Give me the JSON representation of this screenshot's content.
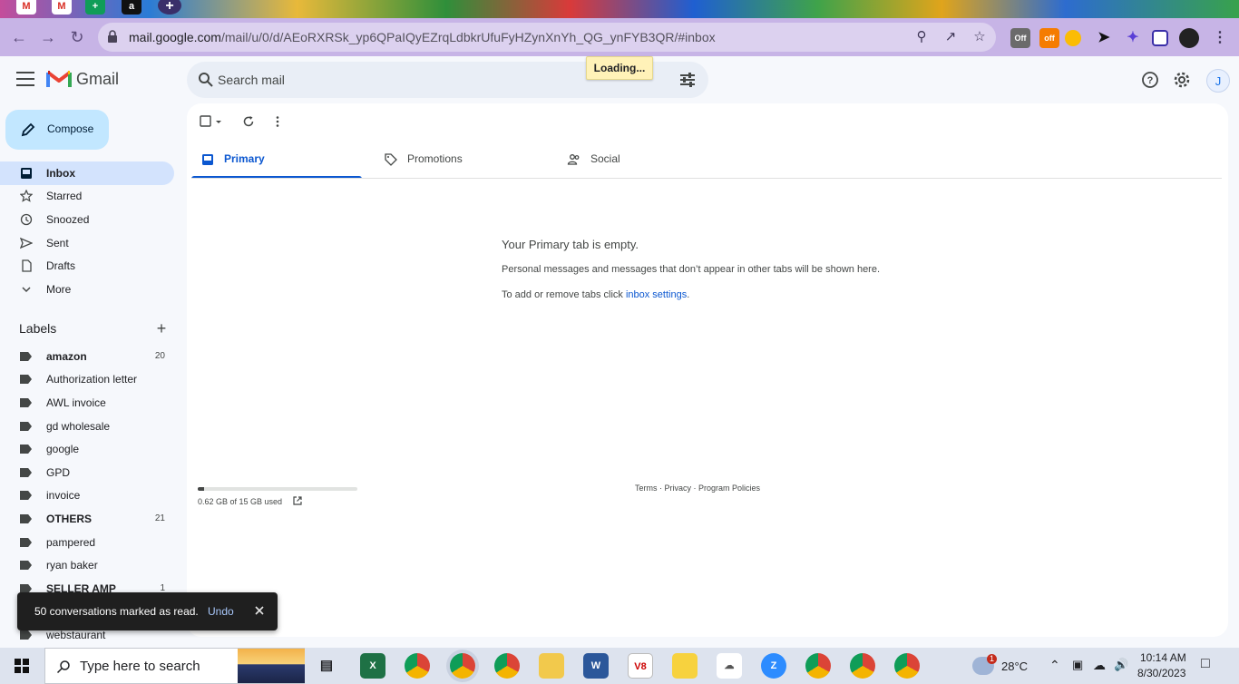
{
  "browser": {
    "url_host": "mail.google.com",
    "url_path": "/mail/u/0/d/AEoRXRSk_yp6QPaIQyEZrqLdbkrUfuFyHZynXnYh_QG_ynFYB3QR/#inbox",
    "ext_off_1": "Off",
    "ext_off_2": "off",
    "loading": "Loading..."
  },
  "header": {
    "app_name": "Gmail",
    "search_placeholder": "Search mail",
    "avatar_initial": "J"
  },
  "compose_label": "Compose",
  "nav": [
    {
      "label": "Inbox",
      "icon": "inbox-icon",
      "active": true
    },
    {
      "label": "Starred",
      "icon": "star-icon"
    },
    {
      "label": "Snoozed",
      "icon": "clock-icon"
    },
    {
      "label": "Sent",
      "icon": "send-icon"
    },
    {
      "label": "Drafts",
      "icon": "draft-icon"
    },
    {
      "label": "More",
      "icon": "chevron-down-icon"
    }
  ],
  "labels_title": "Labels",
  "labels": [
    {
      "name": "amazon",
      "count": "20",
      "bold": true
    },
    {
      "name": "Authorization letter",
      "count": ""
    },
    {
      "name": "AWL invoice",
      "count": ""
    },
    {
      "name": "gd wholesale",
      "count": ""
    },
    {
      "name": "google",
      "count": ""
    },
    {
      "name": "GPD",
      "count": ""
    },
    {
      "name": "invoice",
      "count": ""
    },
    {
      "name": "OTHERS",
      "count": "21",
      "bold": true
    },
    {
      "name": "pampered",
      "count": ""
    },
    {
      "name": "ryan baker",
      "count": ""
    },
    {
      "name": "SELLER AMP",
      "count": "1",
      "bold": true
    },
    {
      "name": "webstaurant",
      "count": ""
    }
  ],
  "tabs": [
    {
      "label": "Primary",
      "icon": "inbox-tab-icon",
      "active": true
    },
    {
      "label": "Promotions",
      "icon": "tag-icon"
    },
    {
      "label": "Social",
      "icon": "people-icon"
    }
  ],
  "empty": {
    "title": "Your Primary tab is empty.",
    "line1": "Personal messages and messages that don’t appear in other tabs will be shown here.",
    "line2_prefix": "To add or remove tabs click ",
    "line2_link": "inbox settings",
    "line2_suffix": "."
  },
  "storage": {
    "text": "0.62 GB of 15 GB used",
    "fraction": 0.04
  },
  "footer": "Terms · Privacy · Program Policies",
  "toast": {
    "text": "50 conversations marked as read.",
    "undo": "Undo"
  },
  "taskbar": {
    "search_placeholder": "Type here to search",
    "weather": "28°C",
    "weather_badge": "1",
    "time": "10:14 AM",
    "date": "8/30/2023"
  },
  "colors": {
    "accent": "#0b57d0",
    "compose": "#c2e7ff",
    "active_nav": "#d3e3fd"
  }
}
